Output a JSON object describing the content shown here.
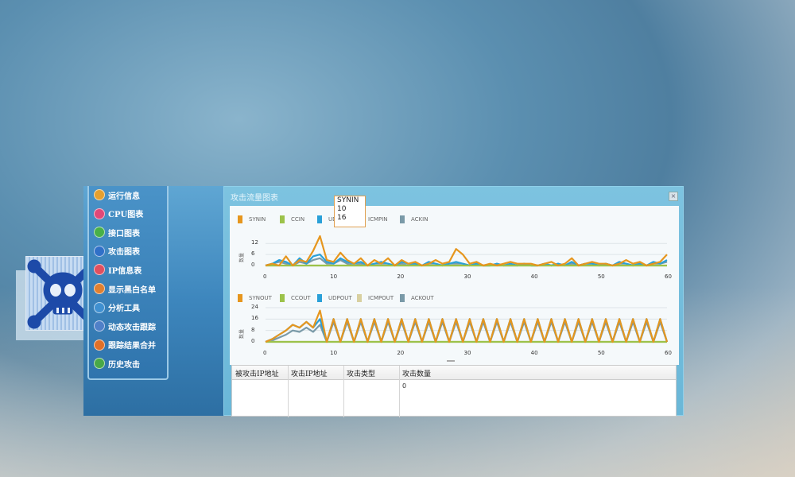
{
  "sidebar": {
    "items": [
      {
        "label": "运行信息",
        "icon": "info-icon",
        "color": "#e6a030"
      },
      {
        "label": "CPU图表",
        "icon": "cpu-icon",
        "color": "#e04878"
      },
      {
        "label": "接口图表",
        "icon": "interface-icon",
        "color": "#48b048"
      },
      {
        "label": "攻击图表",
        "icon": "attack-chart-icon",
        "color": "#3070c8"
      },
      {
        "label": "IP信息表",
        "icon": "ip-icon",
        "color": "#e05060"
      },
      {
        "label": "显示黑白名单",
        "icon": "list-icon",
        "color": "#e08030"
      },
      {
        "label": "分析工具",
        "icon": "tool-icon",
        "color": "#4090d0"
      },
      {
        "label": "动态攻击跟踪",
        "icon": "track-icon",
        "color": "#5080c8"
      },
      {
        "label": "跟踪结果合并",
        "icon": "merge-icon",
        "color": "#e07028"
      },
      {
        "label": "历史攻击",
        "icon": "history-icon",
        "color": "#48a848"
      }
    ]
  },
  "window": {
    "title": "攻击流量图表",
    "close_label": "×"
  },
  "tooltip": {
    "series": "SYNIN",
    "x": "10",
    "y": "16"
  },
  "chart_data": [
    {
      "type": "line",
      "ylabel": "数量",
      "ylim": [
        0,
        16
      ],
      "yticks": [
        "12",
        "6",
        "0"
      ],
      "xlim": [
        0,
        60
      ],
      "xticks": [
        "0",
        "10",
        "20",
        "30",
        "40",
        "50",
        "60"
      ],
      "legend": "top",
      "series": [
        {
          "name": "SYNIN",
          "color": "#e6961e",
          "values": [
            0,
            1,
            0,
            5,
            0,
            3,
            2,
            8,
            16,
            3,
            2,
            7,
            3,
            1,
            4,
            0,
            3,
            1,
            4,
            0,
            3,
            1,
            2,
            0,
            1,
            3,
            1,
            2,
            9,
            6,
            1,
            2,
            0,
            1,
            0,
            1,
            2,
            1,
            1,
            1,
            0,
            1,
            2,
            0,
            1,
            4,
            0,
            1,
            2,
            1,
            1,
            0,
            1,
            3,
            1,
            2,
            0,
            1,
            2,
            6
          ]
        },
        {
          "name": "CCIN",
          "color": "#9cc24a",
          "values": [
            0,
            0,
            0,
            0,
            0,
            0,
            0,
            0,
            0,
            0,
            0,
            0,
            0,
            0,
            0,
            0,
            0,
            0,
            0,
            0,
            0,
            0,
            0,
            0,
            0,
            0,
            0,
            0,
            0,
            0,
            0,
            0,
            0,
            0,
            0,
            0,
            0,
            0,
            0,
            0,
            0,
            0,
            0,
            0,
            0,
            0,
            0,
            0,
            0,
            0,
            0,
            0,
            0,
            0,
            0,
            0,
            0,
            0,
            0,
            0
          ]
        },
        {
          "name": "UDPIN",
          "color": "#2aa0d8",
          "values": [
            0,
            1,
            3,
            2,
            0,
            4,
            1,
            5,
            6,
            2,
            1,
            4,
            2,
            1,
            2,
            0,
            1,
            2,
            1,
            0,
            2,
            1,
            1,
            0,
            2,
            1,
            0,
            1,
            2,
            1,
            0,
            1,
            0,
            0,
            1,
            0,
            1,
            0,
            1,
            0,
            0,
            1,
            0,
            1,
            0,
            2,
            0,
            1,
            1,
            0,
            1,
            0,
            2,
            1,
            0,
            1,
            0,
            2,
            1,
            3
          ]
        },
        {
          "name": "ICMPIN",
          "color": "#d8d0a0",
          "values": [
            0,
            0,
            0,
            0,
            0,
            0,
            0,
            0,
            0,
            0,
            0,
            0,
            0,
            0,
            0,
            0,
            0,
            0,
            0,
            0,
            0,
            0,
            0,
            0,
            0,
            0,
            0,
            0,
            0,
            0,
            0,
            0,
            0,
            0,
            0,
            0,
            0,
            0,
            0,
            0,
            0,
            0,
            0,
            0,
            0,
            0,
            0,
            0,
            0,
            0,
            0,
            0,
            0,
            0,
            0,
            0,
            0,
            0,
            0,
            0
          ]
        },
        {
          "name": "ACKIN",
          "color": "#7a9aa8",
          "values": [
            0,
            1,
            2,
            1,
            0,
            2,
            1,
            3,
            4,
            1,
            1,
            3,
            1,
            0,
            1,
            0,
            1,
            1,
            1,
            0,
            1,
            0,
            1,
            0,
            1,
            1,
            0,
            1,
            1,
            1,
            0,
            1,
            0,
            0,
            1,
            0,
            0,
            0,
            1,
            0,
            0,
            1,
            0,
            1,
            0,
            1,
            0,
            1,
            1,
            0,
            1,
            0,
            1,
            1,
            0,
            1,
            0,
            1,
            1,
            2
          ]
        }
      ]
    },
    {
      "type": "line",
      "ylabel": "数量",
      "ylim": [
        0,
        24
      ],
      "yticks": [
        "24",
        "16",
        "8",
        "0"
      ],
      "xlim": [
        0,
        60
      ],
      "xticks": [
        "0",
        "10",
        "20",
        "30",
        "40",
        "50",
        "60"
      ],
      "legend": "top",
      "series": [
        {
          "name": "SYNOUT",
          "color": "#e6961e",
          "values": [
            0,
            2,
            5,
            8,
            12,
            10,
            14,
            10,
            22,
            0,
            16,
            0,
            16,
            0,
            16,
            0,
            16,
            0,
            16,
            0,
            16,
            0,
            16,
            0,
            16,
            0,
            16,
            0,
            16,
            0,
            16,
            0,
            16,
            0,
            16,
            0,
            16,
            0,
            16,
            0,
            16,
            0,
            16,
            0,
            16,
            0,
            16,
            0,
            16,
            0,
            16,
            0,
            16,
            0,
            16,
            0,
            16,
            0,
            16,
            0
          ]
        },
        {
          "name": "CCOUT",
          "color": "#9cc24a",
          "values": [
            0,
            0,
            0,
            0,
            0,
            0,
            0,
            0,
            0,
            0,
            0,
            0,
            0,
            0,
            0,
            0,
            0,
            0,
            0,
            0,
            0,
            0,
            0,
            0,
            0,
            0,
            0,
            0,
            0,
            0,
            0,
            0,
            0,
            0,
            0,
            0,
            0,
            0,
            0,
            0,
            0,
            0,
            0,
            0,
            0,
            0,
            0,
            0,
            0,
            0,
            0,
            0,
            0,
            0,
            0,
            0,
            0,
            0,
            0,
            0
          ]
        },
        {
          "name": "UDPOUT",
          "color": "#2aa0d8",
          "values": [
            0,
            2,
            5,
            8,
            12,
            10,
            14,
            10,
            16,
            0,
            16,
            0,
            16,
            0,
            16,
            0,
            16,
            0,
            16,
            0,
            16,
            0,
            16,
            0,
            16,
            0,
            16,
            0,
            16,
            0,
            16,
            0,
            16,
            0,
            16,
            0,
            16,
            0,
            16,
            0,
            16,
            0,
            16,
            0,
            16,
            0,
            16,
            0,
            16,
            0,
            16,
            0,
            16,
            0,
            16,
            0,
            16,
            0,
            16,
            0
          ]
        },
        {
          "name": "ICMPOUT",
          "color": "#d8d0a0",
          "values": [
            0,
            0,
            0,
            0,
            0,
            0,
            0,
            0,
            0,
            0,
            0,
            0,
            0,
            0,
            0,
            0,
            0,
            0,
            0,
            0,
            0,
            0,
            0,
            0,
            0,
            0,
            0,
            0,
            0,
            0,
            0,
            0,
            0,
            0,
            0,
            0,
            0,
            0,
            0,
            0,
            0,
            0,
            0,
            0,
            0,
            0,
            0,
            0,
            0,
            0,
            0,
            0,
            0,
            0,
            0,
            0,
            0,
            0,
            0,
            0
          ]
        },
        {
          "name": "ACKOUT",
          "color": "#7a9aa8",
          "values": [
            0,
            1,
            3,
            5,
            8,
            7,
            10,
            7,
            12,
            0,
            14,
            0,
            14,
            0,
            14,
            0,
            14,
            0,
            14,
            0,
            14,
            0,
            14,
            0,
            14,
            0,
            14,
            0,
            14,
            0,
            14,
            0,
            14,
            0,
            14,
            0,
            14,
            0,
            14,
            0,
            14,
            0,
            14,
            0,
            14,
            0,
            14,
            0,
            14,
            0,
            14,
            0,
            14,
            0,
            14,
            0,
            14,
            0,
            14,
            0
          ]
        }
      ]
    }
  ],
  "table": {
    "columns": [
      "被攻击IP地址",
      "攻击IP地址",
      "攻击类型",
      "攻击数量"
    ],
    "rows": [
      [
        "",
        "",
        "",
        "0"
      ]
    ]
  }
}
